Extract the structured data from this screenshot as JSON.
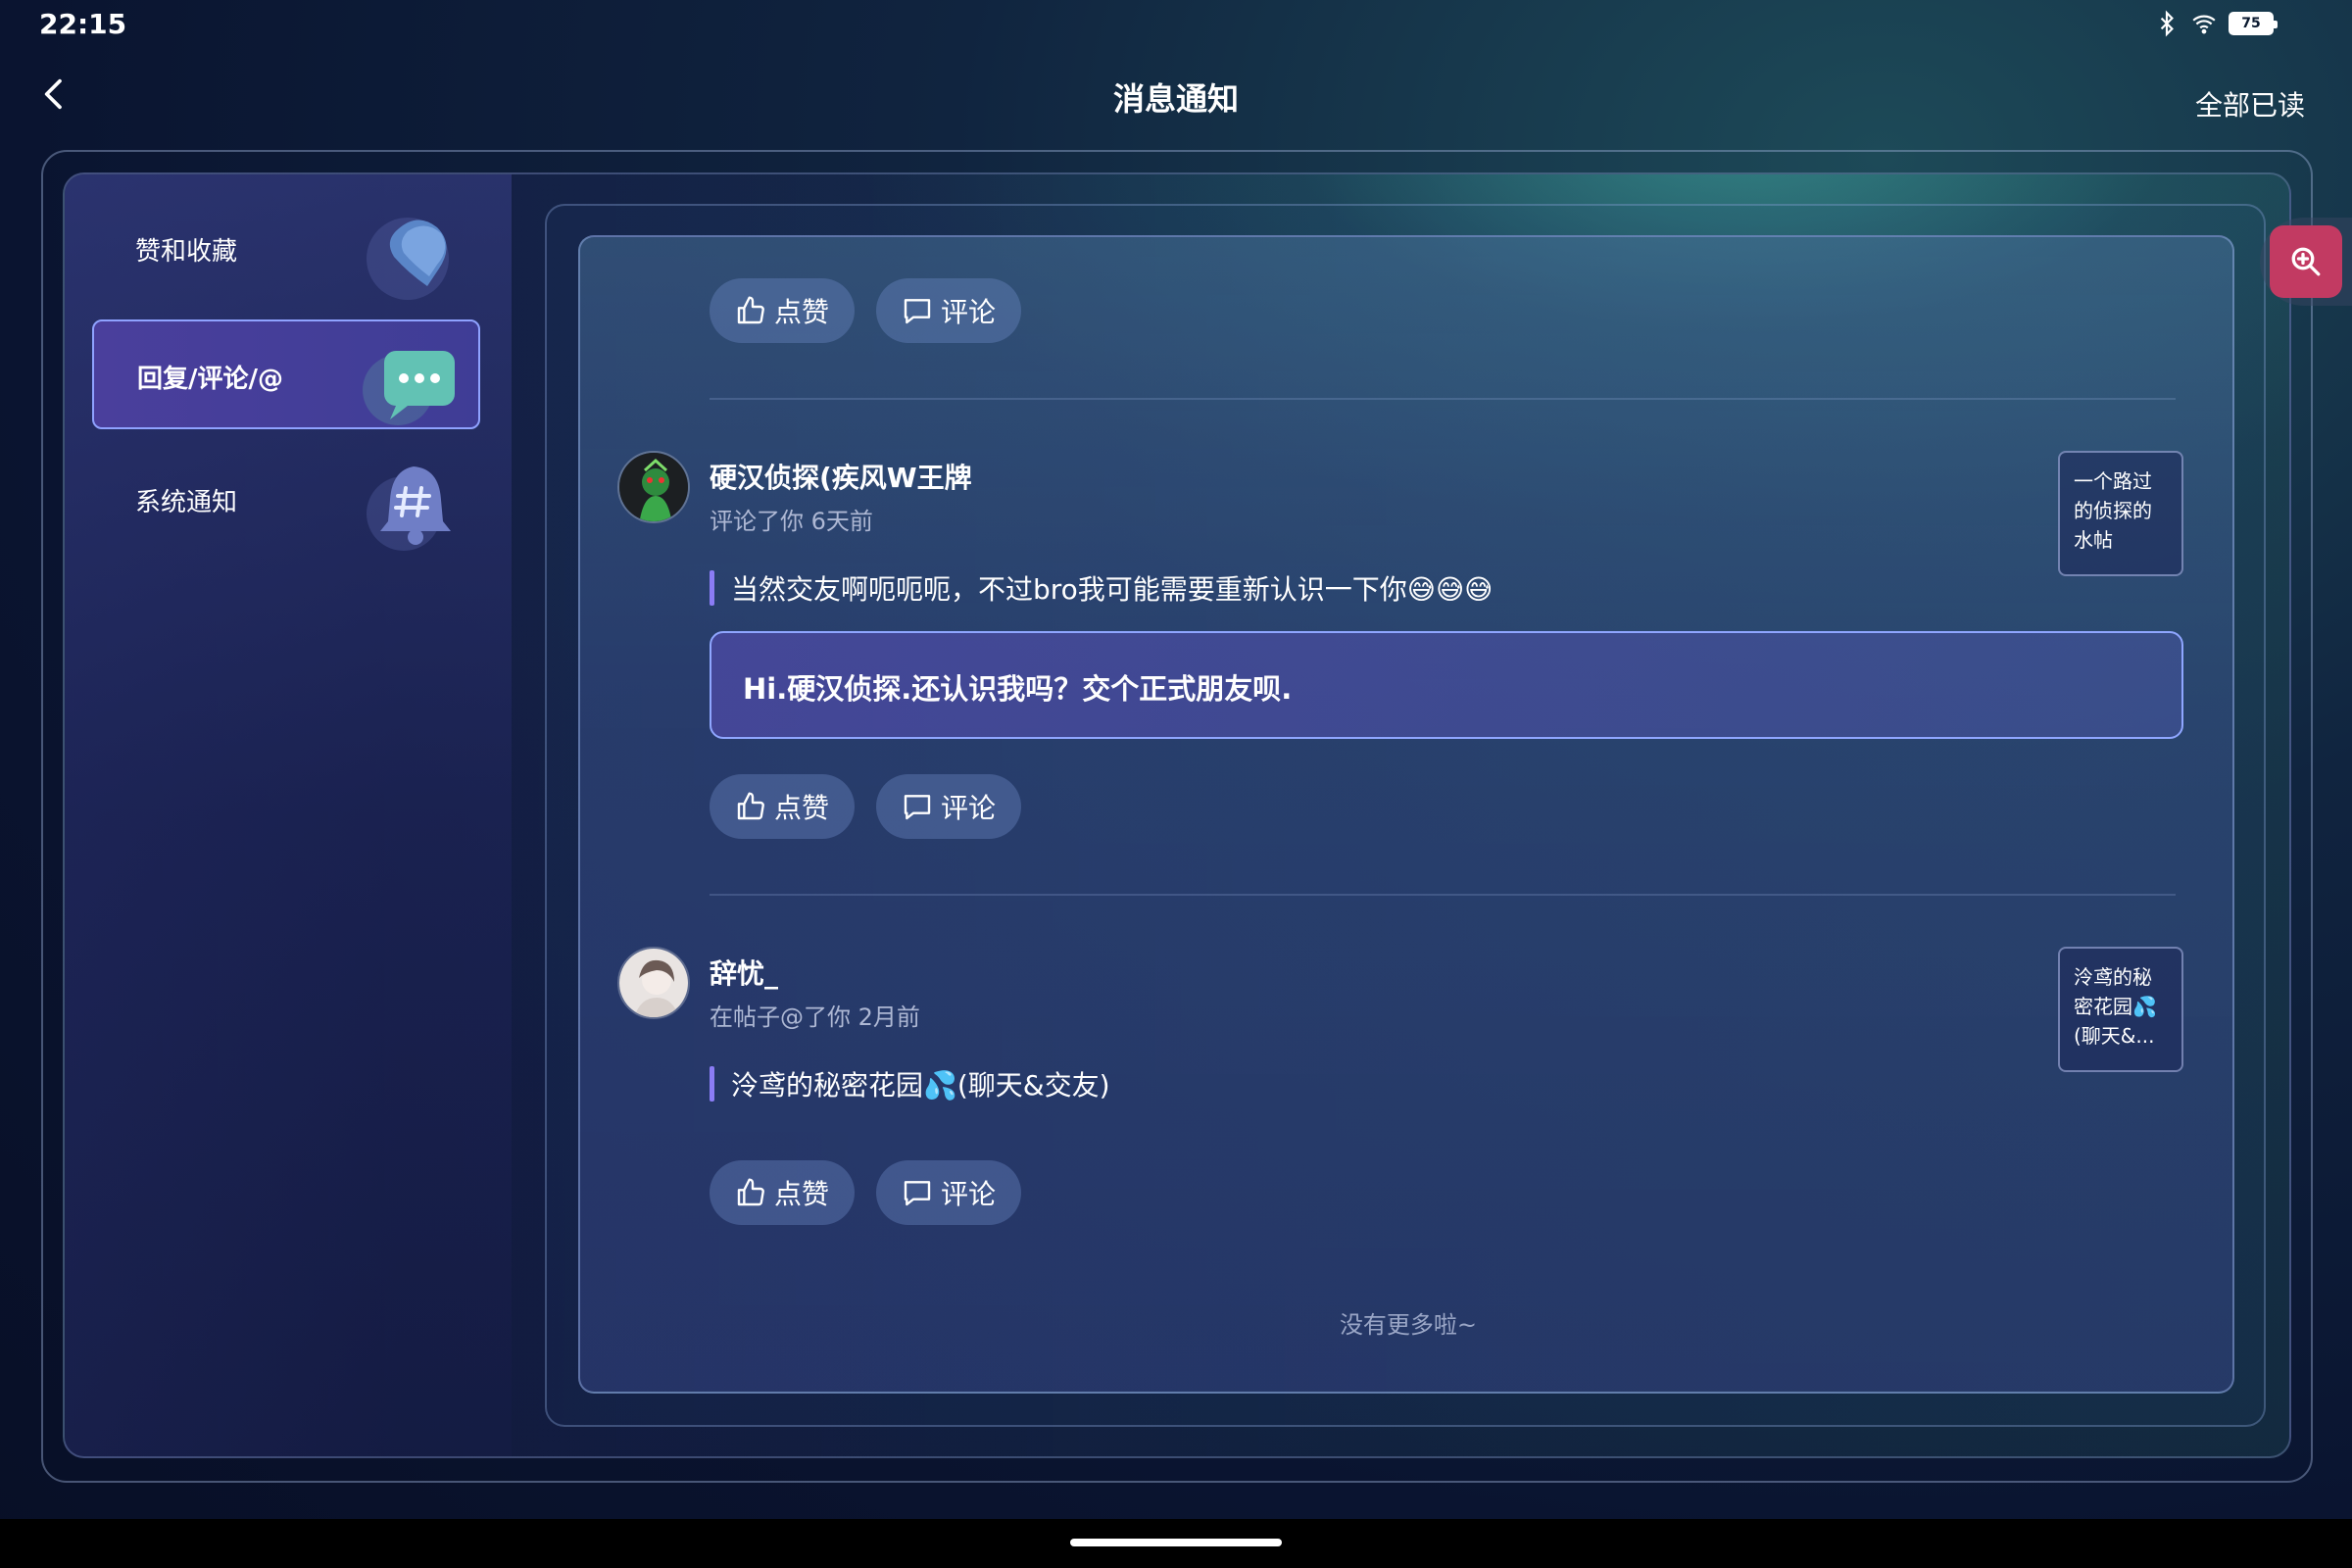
{
  "status_bar": {
    "time": "22:15",
    "battery_level": "75"
  },
  "header": {
    "title": "消息通知",
    "mark_all_read": "全部已读"
  },
  "sidebar": {
    "items": [
      {
        "label": "赞和收藏",
        "icon": "heart-bubble-icon",
        "active": false
      },
      {
        "label": "回复/评论/@",
        "icon": "chat-bubble-icon",
        "active": true
      },
      {
        "label": "系统通知",
        "icon": "bell-hash-icon",
        "active": false
      }
    ]
  },
  "actions": {
    "like_label": "点赞",
    "comment_label": "评论"
  },
  "notifications": [
    {
      "user_name": "硬汉侦探(疾风W王牌",
      "meta": "评论了你 6天前",
      "quote": "当然交友啊呃呃呃，不过bro我可能需要重新认识一下你😅😅😅",
      "reply": "Hi.硬汉侦探.还认识我吗？交个正式朋友呗.",
      "post_thumb": "一个路过的侦探的水帖"
    },
    {
      "user_name": "辞忧_",
      "meta": "在帖子@了你 2月前",
      "quote": "泠鸢的秘密花园💦(聊天&交友)",
      "post_thumb": "泠鸢的秘密花园💦(聊天&..."
    }
  ],
  "footer": {
    "no_more": "没有更多啦~"
  },
  "colors": {
    "accent": "#8b7cf5",
    "active_border": "#8fa2ff",
    "search_button": "#c23a62"
  }
}
